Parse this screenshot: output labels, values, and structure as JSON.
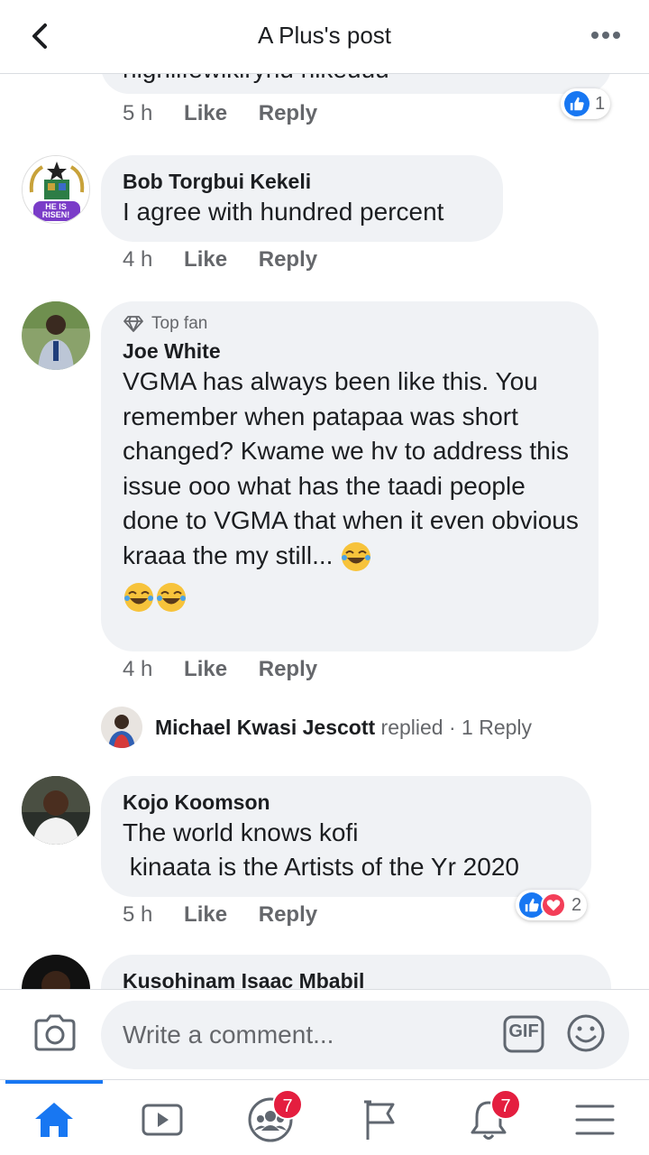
{
  "header": {
    "title": "A Plus's post"
  },
  "comments": [
    {
      "partial_text": "highlifewikiryhu hikeuuu",
      "time": "5 h",
      "like": "Like",
      "reply": "Reply",
      "reaction_count": "1"
    },
    {
      "name": "Bob Torgbui Kekeli",
      "avatar_text_1": "HE IS",
      "avatar_text_2": "RISEN!",
      "text": "I agree with hundred percent",
      "time": "4 h",
      "like": "Like",
      "reply": "Reply"
    },
    {
      "badge": "Top fan",
      "name": "Joe White",
      "text": "VGMA has always been like this. You remember when patapaa was short changed? Kwame we hv to address this issue ooo what has the taadi people done to VGMA that when it even obvious kraaa the my still...",
      "time": "4 h",
      "like": "Like",
      "reply": "Reply",
      "replied_by": "Michael Kwasi Jescott",
      "replied_word": "replied",
      "reply_count": "· 1 Reply"
    },
    {
      "name": "Kojo Koomson",
      "line1": "The world knows kofi",
      "line2": " kinaata is the Artists of the Yr 2020",
      "time": "5 h",
      "like": "Like",
      "reply": "Reply",
      "reaction_count": "2"
    },
    {
      "name": "Kusohinam Isaac Mbabil"
    }
  ],
  "composer": {
    "placeholder": "Write a comment...",
    "gif": "GIF"
  },
  "tabs": {
    "groups_badge": "7",
    "notifications_badge": "7"
  },
  "colors": {
    "accent": "#1877f2",
    "bubble": "#f0f2f5",
    "badge": "#e41e3f"
  }
}
